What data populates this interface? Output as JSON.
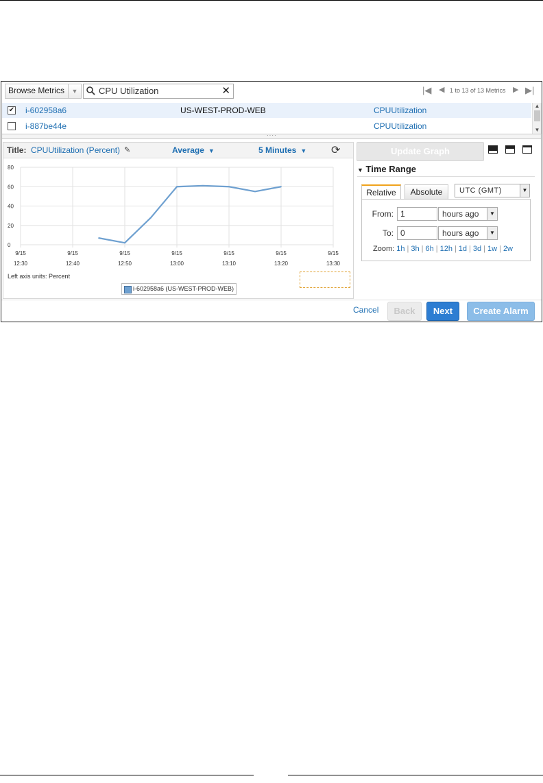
{
  "toolbar": {
    "browse_label": "Browse Metrics",
    "search_value": "CPU Utilization",
    "pager_text": "1 to 13 of 13 Metrics"
  },
  "metrics": [
    {
      "instance": "i-602958a6",
      "name": "US-WEST-PROD-WEB",
      "metric": "CPUUtilization",
      "checked": true
    },
    {
      "instance": "i-887be44e",
      "name": "",
      "metric": "CPUUtilization",
      "checked": false
    }
  ],
  "graph": {
    "title_label": "Title:",
    "title_value": "CPUUtilization (Percent)",
    "statistic": "Average",
    "period": "5 Minutes",
    "units_label": "Left axis units:",
    "units_value": "Percent",
    "legend": "i-602958a6 (US-WEST-PROD-WEB)"
  },
  "chart_data": {
    "type": "line",
    "x": [
      "9/15 12:30",
      "9/15 12:40",
      "9/15 12:50",
      "9/15 13:00",
      "9/15 13:10",
      "9/15 13:20",
      "9/15 13:30"
    ],
    "y_ticks": [
      0,
      20,
      40,
      60,
      80
    ],
    "ylim": [
      0,
      80
    ],
    "series": [
      {
        "name": "i-602958a6 (US-WEST-PROD-WEB)",
        "color": "#6ea0d0",
        "points": [
          {
            "x": "9/15 12:45",
            "y": 7
          },
          {
            "x": "9/15 12:50",
            "y": 2
          },
          {
            "x": "9/15 12:55",
            "y": 28
          },
          {
            "x": "9/15 13:00",
            "y": 60
          },
          {
            "x": "9/15 13:05",
            "y": 61
          },
          {
            "x": "9/15 13:10",
            "y": 60
          },
          {
            "x": "9/15 13:15",
            "y": 55
          },
          {
            "x": "9/15 13:20",
            "y": 60
          }
        ]
      }
    ]
  },
  "update_button": "Update Graph",
  "time_range": {
    "title": "Time Range",
    "tabs": [
      "Relative",
      "Absolute"
    ],
    "timezone": "UTC (GMT)",
    "from_label": "From:",
    "from_value": "1",
    "from_unit": "hours ago",
    "to_label": "To:",
    "to_value": "0",
    "to_unit": "hours ago",
    "zoom_label": "Zoom:",
    "zoom_options": [
      "1h",
      "3h",
      "6h",
      "12h",
      "1d",
      "3d",
      "1w",
      "2w"
    ]
  },
  "footer": {
    "cancel": "Cancel",
    "back": "Back",
    "next": "Next",
    "create_alarm": "Create Alarm"
  },
  "colors": {
    "link": "#1f6fb2",
    "primary_button": "#2d7dd2",
    "tab_accent": "#f0a21b"
  }
}
